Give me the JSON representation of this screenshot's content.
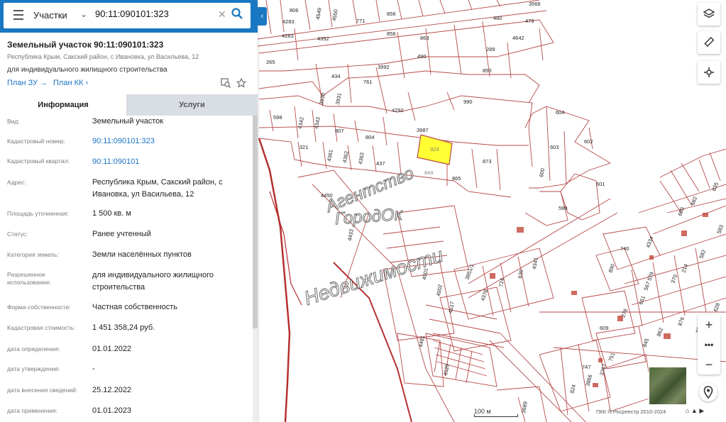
{
  "search": {
    "type": "Участки",
    "query": "90:11:090101:323"
  },
  "parcel": {
    "title": "Земельный участок 90:11:090101:323",
    "address_short": "Республика Крым, Сакский район, с Ивановка, ул Васильева, 12",
    "permitted_use": "для индивидуального жилищного строительства",
    "plan_zu": "План ЗУ",
    "plan_kk": "План КК"
  },
  "tabs": {
    "info": "Информация",
    "services": "Услуги"
  },
  "info_rows": [
    {
      "label": "Вид:",
      "value": "Земельный участок"
    },
    {
      "label": "Кадастровый номер:",
      "value": "90:11:090101:323"
    },
    {
      "label": "Кадастровый квартал:",
      "value": "90:11:090101"
    },
    {
      "label": "Адрес:",
      "value": "Республика Крым, Сакский район, с Ивановка, ул Васильева, 12"
    },
    {
      "label": "Площадь уточненная:",
      "value": "1 500 кв. м"
    },
    {
      "label": "Статус:",
      "value": "Ранее учтенный"
    },
    {
      "label": "Категория земель:",
      "value": "Земли населённых пунктов"
    },
    {
      "label": "Разрешенное использование:",
      "value": "для индивидуального жилищного строительства"
    },
    {
      "label": "Форма собственности:",
      "value": "Частная собственность"
    },
    {
      "label": "Кадастровая стоимость:",
      "value": "1 451 358,24 руб."
    },
    {
      "label": "дата определения:",
      "value": "01.01.2022"
    },
    {
      "label": "дата утверждения:",
      "value": "-"
    },
    {
      "label": "дата внесения сведений:",
      "value": "25.12.2022"
    },
    {
      "label": "дата применения:",
      "value": "01.01.2023"
    }
  ],
  "map": {
    "watermark": [
      "Агентство",
      "ГородОк",
      "Недвижимости"
    ],
    "scale": "100 м",
    "copyright": "ПКК © Росреестр 2010-2024",
    "lots": [
      "806",
      "4549",
      "4550",
      "771",
      "856",
      "480",
      "479",
      "3566",
      "4283",
      "4352",
      "856",
      "863",
      "4642",
      "289",
      "265",
      "3992",
      "490",
      "850",
      "434",
      "761",
      "3930",
      "3931",
      "990",
      "4292",
      "598",
      "4342",
      "4343",
      "807",
      "804",
      "3987",
      "604",
      "321",
      "4361",
      "4362",
      "4363",
      "437",
      "323",
      "849",
      "865",
      "873",
      "603",
      "602",
      "600",
      "601",
      "599",
      "740",
      "890",
      "4341",
      "630",
      "724",
      "4376",
      "4501",
      "4502",
      "4517",
      "609",
      "4481",
      "4529",
      "747",
      "751",
      "3767",
      "3866",
      "824",
      "3689",
      "4450",
      "4433"
    ],
    "accent": "#1a78c2",
    "selected_fill": "#ffff33",
    "border_color": "#b54a4a"
  }
}
